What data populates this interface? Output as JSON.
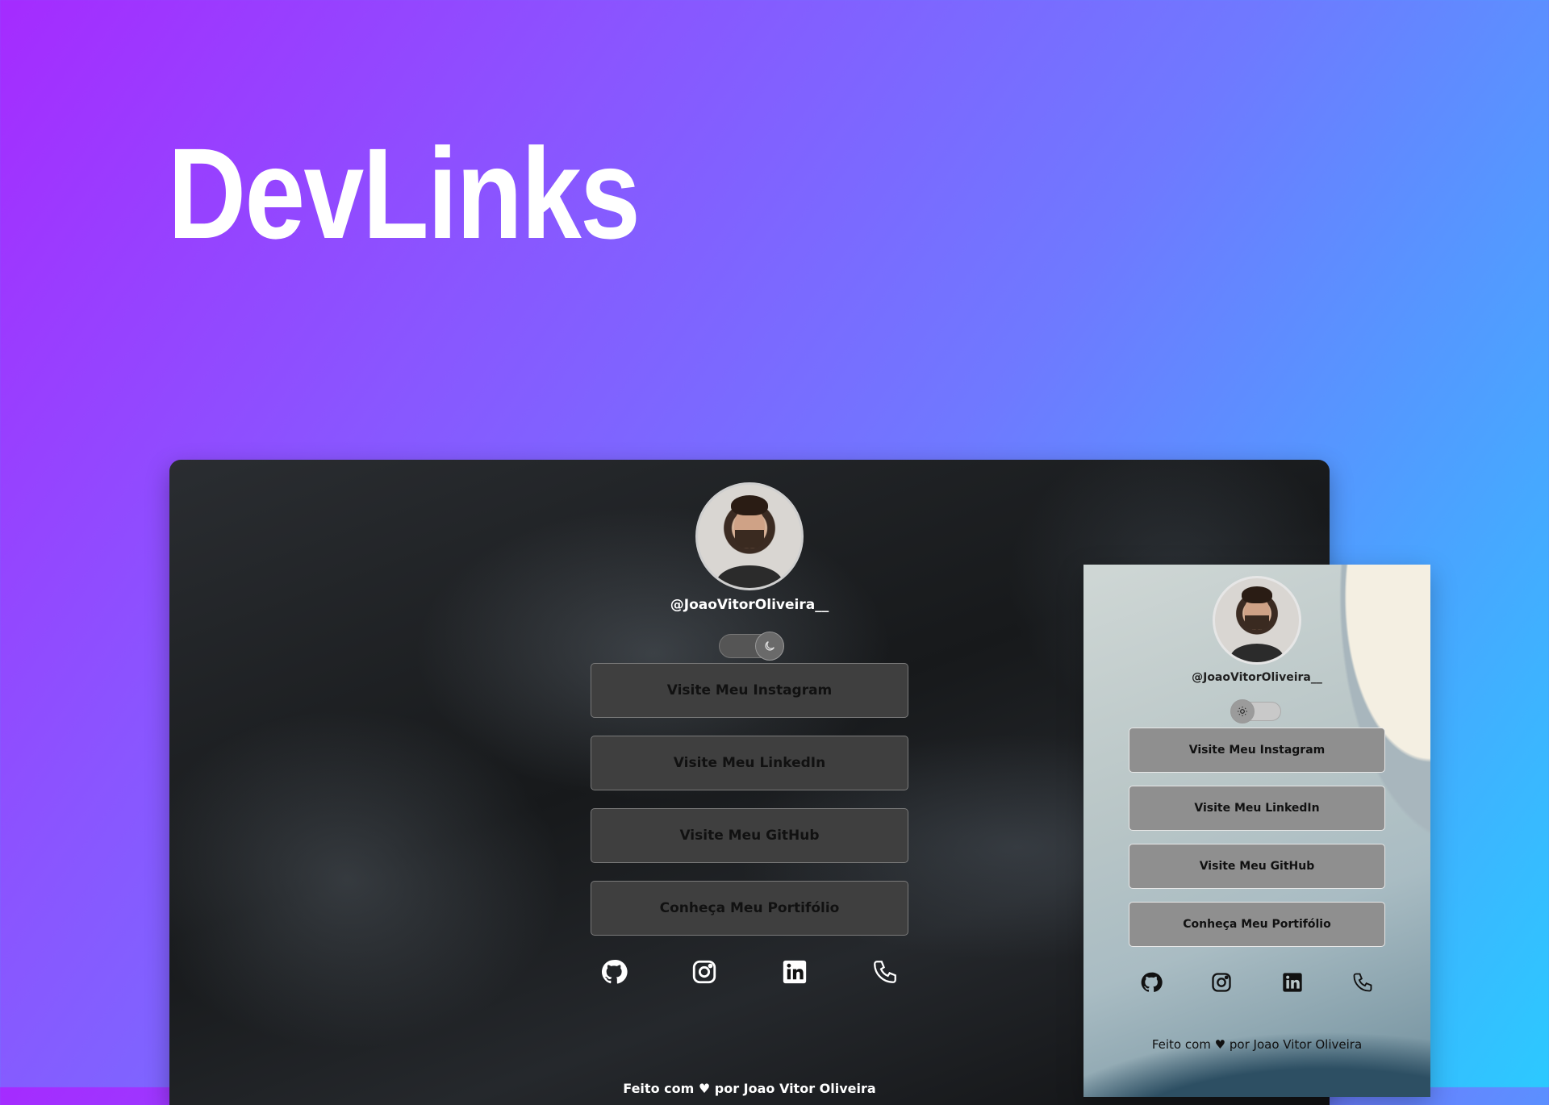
{
  "page": {
    "title": "DevLinks"
  },
  "desktop": {
    "handle": "@JoaoVitorOliveira__",
    "theme_toggle_icon": "moon-icon",
    "buttons": [
      {
        "label": "Visite Meu Instagram"
      },
      {
        "label": "Visite Meu LinkedIn"
      },
      {
        "label": "Visite Meu GitHub"
      },
      {
        "label": "Conheça Meu Portifólio"
      }
    ],
    "socials": [
      "github-icon",
      "instagram-icon",
      "linkedin-icon",
      "phone-icon"
    ],
    "footer": "Feito com ♥ por Joao Vitor Oliveira"
  },
  "mobile": {
    "handle": "@JoaoVitorOliveira__",
    "theme_toggle_icon": "sun-icon",
    "buttons": [
      {
        "label": "Visite Meu Instagram"
      },
      {
        "label": "Visite Meu LinkedIn"
      },
      {
        "label": "Visite Meu GitHub"
      },
      {
        "label": "Conheça Meu Portifólio"
      }
    ],
    "socials": [
      "github-icon",
      "instagram-icon",
      "linkedin-icon",
      "phone-icon"
    ],
    "footer": "Feito com ♥ por Joao Vitor Oliveira"
  },
  "colors": {
    "gradient_start": "#a52bff",
    "gradient_end": "#2cc9ff",
    "desktop_button_bg": "#3f3f3f",
    "mobile_button_bg": "#8f8f8f"
  }
}
